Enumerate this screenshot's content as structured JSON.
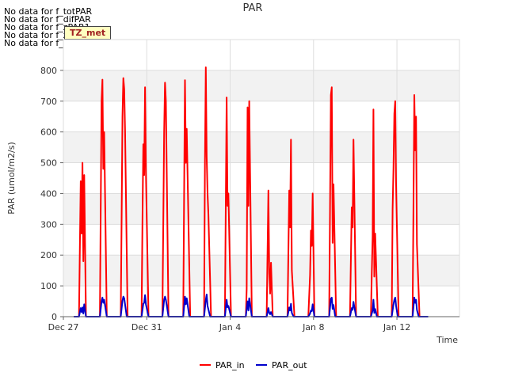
{
  "notes": [
    "No data for f_totPAR",
    "No data for f_difPAR",
    "No data for f_zPAR1",
    "No data for f_zPAR2",
    "No data for f_zPAR3"
  ],
  "badge": "TZ_met",
  "chart_data": {
    "type": "line",
    "title": "PAR",
    "xlabel": "Time",
    "ylabel": "PAR (umol/m2/s)",
    "xlim": [
      "2023-12-27",
      "2024-01-15"
    ],
    "ylim": [
      0,
      900
    ],
    "yticks": [
      0,
      100,
      200,
      300,
      400,
      500,
      600,
      700,
      800
    ],
    "xticks": [
      {
        "date": "2023-12-27",
        "label": "Dec 27"
      },
      {
        "date": "2023-12-31",
        "label": "Dec 31"
      },
      {
        "date": "2024-01-04",
        "label": "Jan 4"
      },
      {
        "date": "2024-01-08",
        "label": "Jan 8"
      },
      {
        "date": "2024-01-12",
        "label": "Jan 12"
      }
    ],
    "grid": true,
    "legend_position": "bottom",
    "series": [
      {
        "name": "PAR_in",
        "color": "#ff0000",
        "points": [
          [
            "2023-12-27 12:00",
            0
          ],
          [
            "2023-12-27 18:00",
            0
          ],
          [
            "2023-12-27 20:00",
            440
          ],
          [
            "2023-12-27 21:00",
            270
          ],
          [
            "2023-12-27 22:00",
            500
          ],
          [
            "2023-12-27 23:00",
            180
          ],
          [
            "2023-12-28 00:00",
            460
          ],
          [
            "2023-12-28 02:00",
            0
          ],
          [
            "2023-12-28 18:00",
            0
          ],
          [
            "2023-12-28 20:00",
            700
          ],
          [
            "2023-12-28 21:00",
            770
          ],
          [
            "2023-12-28 22:00",
            480
          ],
          [
            "2023-12-28 23:00",
            600
          ],
          [
            "2023-12-29 02:00",
            0
          ],
          [
            "2023-12-29 18:00",
            0
          ],
          [
            "2023-12-29 19:00",
            310
          ],
          [
            "2023-12-29 20:00",
            650
          ],
          [
            "2023-12-29 21:00",
            775
          ],
          [
            "2023-12-29 22:00",
            740
          ],
          [
            "2023-12-29 23:00",
            600
          ],
          [
            "2023-12-30 02:00",
            0
          ],
          [
            "2023-12-30 18:00",
            0
          ],
          [
            "2023-12-30 19:00",
            300
          ],
          [
            "2023-12-30 20:00",
            560
          ],
          [
            "2023-12-30 21:00",
            460
          ],
          [
            "2023-12-30 22:00",
            745
          ],
          [
            "2023-12-30 23:00",
            470
          ],
          [
            "2023-12-31 02:00",
            0
          ],
          [
            "2023-12-31 18:00",
            0
          ],
          [
            "2023-12-31 19:00",
            300
          ],
          [
            "2023-12-31 20:00",
            600
          ],
          [
            "2023-12-31 21:00",
            760
          ],
          [
            "2023-12-31 22:00",
            700
          ],
          [
            "2024-01-01 01:00",
            0
          ],
          [
            "2024-01-01 18:00",
            0
          ],
          [
            "2024-01-01 19:00",
            390
          ],
          [
            "2024-01-01 20:00",
            768
          ],
          [
            "2024-01-01 21:00",
            500
          ],
          [
            "2024-01-01 22:00",
            610
          ],
          [
            "2024-01-01 23:00",
            460
          ],
          [
            "2024-01-02 02:00",
            0
          ],
          [
            "2024-01-02 18:00",
            0
          ],
          [
            "2024-01-02 19:00",
            500
          ],
          [
            "2024-01-02 20:00",
            810
          ],
          [
            "2024-01-02 21:00",
            520
          ],
          [
            "2024-01-02 22:00",
            400
          ],
          [
            "2024-01-02 23:00",
            330
          ],
          [
            "2024-01-03 02:00",
            0
          ],
          [
            "2024-01-03 18:00",
            0
          ],
          [
            "2024-01-03 20:00",
            712
          ],
          [
            "2024-01-03 21:00",
            360
          ],
          [
            "2024-01-03 22:00",
            400
          ],
          [
            "2024-01-04 01:00",
            0
          ],
          [
            "2024-01-04 18:00",
            0
          ],
          [
            "2024-01-04 19:00",
            90
          ],
          [
            "2024-01-04 20:00",
            680
          ],
          [
            "2024-01-04 21:00",
            360
          ],
          [
            "2024-01-04 22:00",
            700
          ],
          [
            "2024-01-05 01:00",
            0
          ],
          [
            "2024-01-05 18:00",
            0
          ],
          [
            "2024-01-05 20:00",
            410
          ],
          [
            "2024-01-05 21:00",
            140
          ],
          [
            "2024-01-05 22:00",
            75
          ],
          [
            "2024-01-05 23:00",
            175
          ],
          [
            "2024-01-06 01:00",
            0
          ],
          [
            "2024-01-06 18:00",
            0
          ],
          [
            "2024-01-06 20:00",
            410
          ],
          [
            "2024-01-06 21:00",
            290
          ],
          [
            "2024-01-06 22:00",
            575
          ],
          [
            "2024-01-06 23:00",
            150
          ],
          [
            "2024-01-07 02:00",
            0
          ],
          [
            "2024-01-07 18:00",
            0
          ],
          [
            "2024-01-07 20:00",
            135
          ],
          [
            "2024-01-07 21:00",
            280
          ],
          [
            "2024-01-07 22:00",
            230
          ],
          [
            "2024-01-07 23:00",
            400
          ],
          [
            "2024-01-08 01:00",
            0
          ],
          [
            "2024-01-08 18:00",
            0
          ],
          [
            "2024-01-08 19:00",
            350
          ],
          [
            "2024-01-08 20:00",
            720
          ],
          [
            "2024-01-08 21:00",
            745
          ],
          [
            "2024-01-08 22:00",
            240
          ],
          [
            "2024-01-08 23:00",
            430
          ],
          [
            "2024-01-09 02:00",
            0
          ],
          [
            "2024-01-09 18:00",
            0
          ],
          [
            "2024-01-09 19:00",
            180
          ],
          [
            "2024-01-09 20:00",
            355
          ],
          [
            "2024-01-09 21:00",
            290
          ],
          [
            "2024-01-09 22:00",
            575
          ],
          [
            "2024-01-10 01:00",
            0
          ],
          [
            "2024-01-10 18:00",
            0
          ],
          [
            "2024-01-10 19:00",
            140
          ],
          [
            "2024-01-10 20:00",
            260
          ],
          [
            "2024-01-10 21:00",
            673
          ],
          [
            "2024-01-10 22:00",
            130
          ],
          [
            "2024-01-10 23:00",
            270
          ],
          [
            "2024-01-11 02:00",
            0
          ],
          [
            "2024-01-11 18:00",
            0
          ],
          [
            "2024-01-11 19:00",
            350
          ],
          [
            "2024-01-11 20:00",
            480
          ],
          [
            "2024-01-11 21:00",
            660
          ],
          [
            "2024-01-11 22:00",
            700
          ],
          [
            "2024-01-11 23:00",
            430
          ],
          [
            "2024-01-12 02:00",
            0
          ],
          [
            "2024-01-12 18:00",
            0
          ],
          [
            "2024-01-12 19:00",
            350
          ],
          [
            "2024-01-12 20:00",
            720
          ],
          [
            "2024-01-12 21:00",
            540
          ],
          [
            "2024-01-12 22:00",
            650
          ],
          [
            "2024-01-12 23:00",
            235
          ],
          [
            "2024-01-13 02:00",
            0
          ],
          [
            "2024-01-13 12:00",
            0
          ]
        ]
      },
      {
        "name": "PAR_out",
        "color": "#0000cc",
        "points": [
          [
            "2023-12-27 12:00",
            0
          ],
          [
            "2023-12-27 18:00",
            0
          ],
          [
            "2023-12-27 20:00",
            28
          ],
          [
            "2023-12-27 21:00",
            15
          ],
          [
            "2023-12-27 22:00",
            30
          ],
          [
            "2023-12-27 23:00",
            10
          ],
          [
            "2023-12-28 00:00",
            40
          ],
          [
            "2023-12-28 02:00",
            0
          ],
          [
            "2023-12-28 18:00",
            0
          ],
          [
            "2023-12-28 20:00",
            50
          ],
          [
            "2023-12-28 21:00",
            62
          ],
          [
            "2023-12-28 22:00",
            45
          ],
          [
            "2023-12-28 23:00",
            55
          ],
          [
            "2023-12-29 02:00",
            0
          ],
          [
            "2023-12-29 18:00",
            0
          ],
          [
            "2023-12-29 20:00",
            52
          ],
          [
            "2023-12-29 21:00",
            65
          ],
          [
            "2023-12-29 22:00",
            60
          ],
          [
            "2023-12-30 01:00",
            0
          ],
          [
            "2023-12-30 18:00",
            0
          ],
          [
            "2023-12-30 20:00",
            42
          ],
          [
            "2023-12-30 21:00",
            45
          ],
          [
            "2023-12-30 22:00",
            70
          ],
          [
            "2023-12-30 23:00",
            40
          ],
          [
            "2023-12-31 02:00",
            0
          ],
          [
            "2023-12-31 18:00",
            0
          ],
          [
            "2023-12-31 20:00",
            55
          ],
          [
            "2023-12-31 21:00",
            65
          ],
          [
            "2023-12-31 22:00",
            55
          ],
          [
            "2024-01-01 01:00",
            0
          ],
          [
            "2024-01-01 18:00",
            0
          ],
          [
            "2024-01-01 20:00",
            65
          ],
          [
            "2024-01-01 21:00",
            40
          ],
          [
            "2024-01-01 22:00",
            60
          ],
          [
            "2024-01-02 01:00",
            0
          ],
          [
            "2024-01-02 18:00",
            0
          ],
          [
            "2024-01-02 20:00",
            55
          ],
          [
            "2024-01-02 21:00",
            72
          ],
          [
            "2024-01-02 22:00",
            35
          ],
          [
            "2024-01-03 01:00",
            0
          ],
          [
            "2024-01-03 18:00",
            0
          ],
          [
            "2024-01-03 20:00",
            55
          ],
          [
            "2024-01-03 21:00",
            30
          ],
          [
            "2024-01-03 22:00",
            35
          ],
          [
            "2024-01-04 01:00",
            0
          ],
          [
            "2024-01-04 18:00",
            0
          ],
          [
            "2024-01-04 20:00",
            50
          ],
          [
            "2024-01-04 21:00",
            20
          ],
          [
            "2024-01-04 22:00",
            60
          ],
          [
            "2024-01-05 01:00",
            0
          ],
          [
            "2024-01-05 18:00",
            0
          ],
          [
            "2024-01-05 20:00",
            28
          ],
          [
            "2024-01-05 21:00",
            12
          ],
          [
            "2024-01-05 22:00",
            8
          ],
          [
            "2024-01-05 23:00",
            15
          ],
          [
            "2024-01-06 01:00",
            0
          ],
          [
            "2024-01-06 18:00",
            0
          ],
          [
            "2024-01-06 20:00",
            30
          ],
          [
            "2024-01-06 21:00",
            20
          ],
          [
            "2024-01-06 22:00",
            42
          ],
          [
            "2024-01-06 23:00",
            12
          ],
          [
            "2024-01-07 01:00",
            0
          ],
          [
            "2024-01-07 18:00",
            0
          ],
          [
            "2024-01-07 20:00",
            10
          ],
          [
            "2024-01-07 21:00",
            20
          ],
          [
            "2024-01-07 22:00",
            18
          ],
          [
            "2024-01-07 23:00",
            40
          ],
          [
            "2024-01-08 01:00",
            0
          ],
          [
            "2024-01-08 18:00",
            0
          ],
          [
            "2024-01-08 20:00",
            58
          ],
          [
            "2024-01-08 21:00",
            62
          ],
          [
            "2024-01-08 22:00",
            25
          ],
          [
            "2024-01-08 23:00",
            38
          ],
          [
            "2024-01-09 01:00",
            0
          ],
          [
            "2024-01-09 18:00",
            0
          ],
          [
            "2024-01-09 20:00",
            28
          ],
          [
            "2024-01-09 21:00",
            22
          ],
          [
            "2024-01-09 22:00",
            48
          ],
          [
            "2024-01-10 01:00",
            0
          ],
          [
            "2024-01-10 18:00",
            0
          ],
          [
            "2024-01-10 20:00",
            20
          ],
          [
            "2024-01-10 21:00",
            55
          ],
          [
            "2024-01-10 22:00",
            12
          ],
          [
            "2024-01-10 23:00",
            25
          ],
          [
            "2024-01-11 01:00",
            0
          ],
          [
            "2024-01-11 18:00",
            0
          ],
          [
            "2024-01-11 20:00",
            40
          ],
          [
            "2024-01-11 21:00",
            55
          ],
          [
            "2024-01-11 22:00",
            62
          ],
          [
            "2024-01-11 23:00",
            35
          ],
          [
            "2024-01-12 01:00",
            0
          ],
          [
            "2024-01-12 18:00",
            0
          ],
          [
            "2024-01-12 20:00",
            62
          ],
          [
            "2024-01-12 21:00",
            45
          ],
          [
            "2024-01-12 22:00",
            55
          ],
          [
            "2024-01-12 23:00",
            22
          ],
          [
            "2024-01-13 01:00",
            0
          ],
          [
            "2024-01-13 12:00",
            0
          ]
        ]
      }
    ]
  }
}
